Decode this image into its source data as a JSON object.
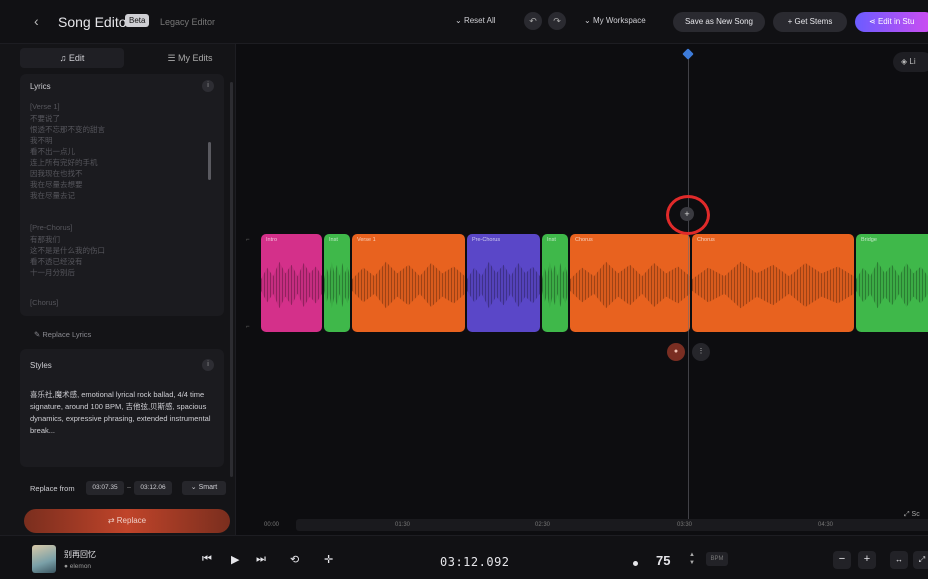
{
  "topbar": {
    "back": "‹",
    "title": "Song Editor",
    "badge": "Beta",
    "legacy": "Legacy Editor",
    "reset": "Reset All",
    "undo": "↶",
    "redo": "↷",
    "workspace": "My Workspace",
    "save": "Save as New Song",
    "stems": "Get Stems",
    "edit_in": "Edit in Stu"
  },
  "left_panel": {
    "tabs": [
      {
        "label": "Edit"
      },
      {
        "label": "My Edits"
      }
    ],
    "lyrics": {
      "header": "Lyrics",
      "lines": [
        "[Verse 1]",
        "不要说了",
        "恨透不忘那不变的甜言",
        "我不明",
        "看不出一点儿",
        "连上所有完好的手机",
        "因我现在也找不",
        "我在尽量去想要",
        "我在尽量去记",
        "",
        "[Pre-Chorus]",
        "有那我们",
        "这不是是什么我的伤口",
        "看不透已经没有",
        "十一月分别后",
        "",
        "[Chorus]"
      ],
      "replace": "Replace Lyrics"
    },
    "styles": {
      "header": "Styles",
      "text": "喜乐社,魔术感, emotional lyrical rock ballad, 4/4 time signature, around 100 BPM, 吉他弦,贝斯感, spacious dynamics, expressive phrasing, extended instrumental break..."
    },
    "replace_from": "Replace from",
    "from_time": "03:07.35",
    "to_time": "03:12.06",
    "smart": "Smart",
    "replace_button": "Replace"
  },
  "timeline": {
    "side_button": "Li",
    "add": "+",
    "segments": [
      {
        "label": "Intro",
        "color": "#d4308a"
      },
      {
        "label": "Inst",
        "color": "#3fb84a"
      },
      {
        "label": "Verse 1",
        "color": "#e8621f"
      },
      {
        "label": "Pre-Chorus",
        "color": "#5a47c8"
      },
      {
        "label": "Inst",
        "color": "#3fb84a"
      },
      {
        "label": "Chorus",
        "color": "#e8621f"
      },
      {
        "label": "Chorus",
        "color": "#e8621f"
      },
      {
        "label": "Bridge",
        "color": "#3fb84a"
      }
    ],
    "ruler_labels": [
      "00:00",
      "01:30",
      "02:30",
      "03:30",
      "04:30"
    ],
    "ruler_right": "⤢ Sc"
  },
  "player": {
    "song": "别再回忆",
    "artist": "● elemon",
    "time": "03:12.092",
    "bpm": "75",
    "bpm_box": "BPM"
  },
  "colors": {
    "accent_blue": "#3d7bd9",
    "highlight_red": "#e02a2a"
  }
}
